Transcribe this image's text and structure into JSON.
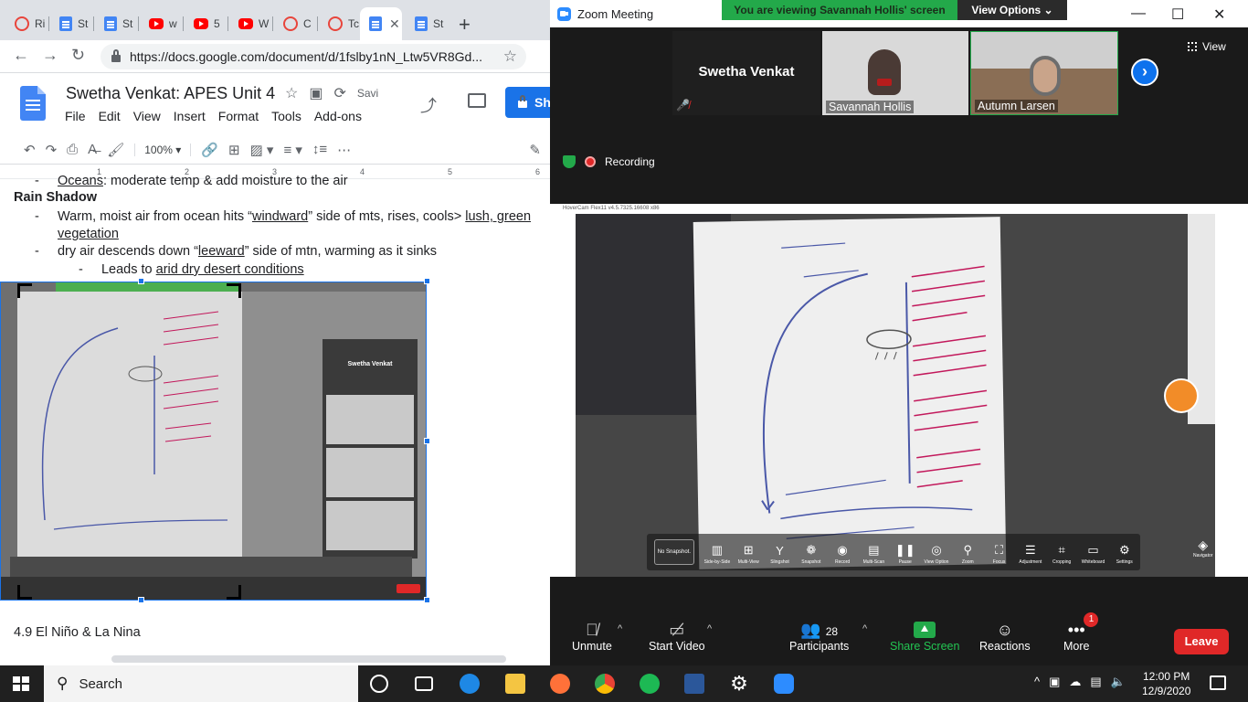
{
  "browser": {
    "tabs": [
      {
        "label": "Ri",
        "icon": "tri-icon"
      },
      {
        "label": "St",
        "icon": "docs-icon"
      },
      {
        "label": "St",
        "icon": "docs-icon"
      },
      {
        "label": "w",
        "icon": "youtube-icon"
      },
      {
        "label": "5",
        "icon": "youtube-icon"
      },
      {
        "label": "W",
        "icon": "youtube-icon"
      },
      {
        "label": "C",
        "icon": "tri-icon"
      },
      {
        "label": "Tc",
        "icon": "tri-icon"
      },
      {
        "label": "",
        "icon": "docs-icon"
      },
      {
        "label": "St",
        "icon": "docs-icon"
      }
    ],
    "url": "https://docs.google.com/document/d/1fslby1nN_Ltw5VR8Gd..."
  },
  "docs": {
    "title": "Swetha Venkat: APES Unit 4",
    "saving": "Savi",
    "menu": [
      "File",
      "Edit",
      "View",
      "Insert",
      "Format",
      "Tools",
      "Add-ons"
    ],
    "share_label": "Sh",
    "zoom": "100%",
    "ruler": [
      "1",
      "2",
      "3",
      "4",
      "5",
      "6"
    ],
    "lines": {
      "oceans_u": "Oceans",
      "oceans_rest": ": moderate temp & add moisture to the air",
      "heading": "Rain Shadow",
      "b1_a": "Warm, moist air from ocean hits “",
      "b1_u": "windward",
      "b1_b": "” side of mts, rises, cools> ",
      "b1_u2": "lush, green",
      "b1_u3": "vegetation",
      "b2_a": "dry air descends down “",
      "b2_u": "leeward",
      "b2_b": "” side of mtn, warming as it sinks",
      "b3_a": "Leads to ",
      "b3_u": "arid dry desert conditions",
      "next_heading": "4.9 El Niño & La Nina"
    },
    "embed": {
      "presenter": "Swetha Venkat"
    }
  },
  "zoom": {
    "window_title": "Zoom Meeting",
    "banner": "You are viewing Savannah Hollis' screen",
    "view_options": "View Options",
    "tiles": [
      {
        "name": "Swetha Venkat"
      },
      {
        "name": "Savannah Hollis"
      },
      {
        "name": "Autumn Larsen"
      }
    ],
    "view_label": "View",
    "recording": "Recording",
    "hovercam_title": "HoverCam Flex11 v4.5.7325.16608 x86",
    "toolbar": {
      "no_snapshot": "No Snapshot.",
      "tools": [
        "Side-by-Side",
        "Multi-View",
        "Slingshot",
        "Snapshot",
        "Record",
        "Multi-Scan",
        "Pause",
        "View Option",
        "Zoom",
        "Focus",
        "Adjustment",
        "Cropping",
        "Whiteboard",
        "Settings"
      ],
      "navigator": "Navigator"
    },
    "controls": {
      "unmute": "Unmute",
      "start_video": "Start Video",
      "participants": "Participants",
      "participants_count": "28",
      "share_screen": "Share Screen",
      "reactions": "Reactions",
      "more": "More",
      "more_badge": "1",
      "leave": "Leave"
    }
  },
  "taskbar": {
    "search": "Search",
    "time": "12:00 PM",
    "date": "12/9/2020"
  },
  "colors": {
    "docs_blue": "#4285f4",
    "share_blue": "#1a73e8",
    "zoom_green": "#23a94a",
    "zoom_red": "#e02828",
    "zoom_blue": "#0e72ed"
  }
}
